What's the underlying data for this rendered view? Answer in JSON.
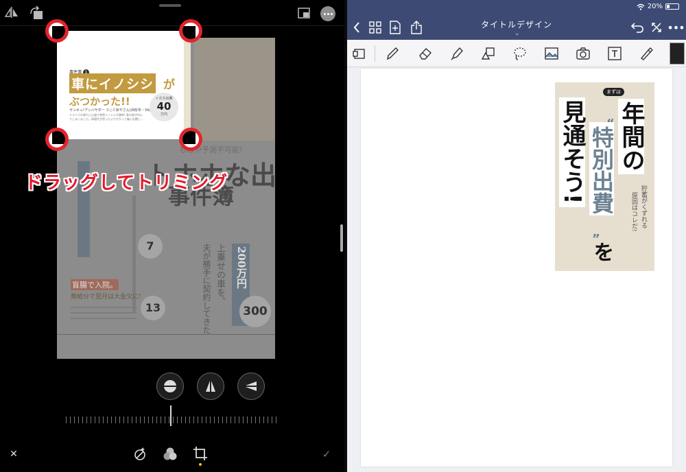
{
  "left_pane": {
    "overlay_label": "ドラッグしてトリミング",
    "photo_crop": {
      "case_tag": "事件簿",
      "case_num": "1",
      "headline_main": "車にイノシシ",
      "headline_particle": "が",
      "headline_sub": "ぶつかった!!",
      "byline": "サンキュ!アンバサダー ミ○ミあやさん(浜松市・34歳)",
      "body": "ドライブの帰りに山道で突然イノシシが激突! 車の前が凹んでしまいました。修理代が思ったよりかかって痛い出費に…",
      "price_label": "トホホ出費",
      "price_value": "40",
      "price_unit": "万円"
    },
    "photo_bg": {
      "big_title_1": "トホホな出費",
      "big_title_2": "事件簿",
      "tagline": "もはや予測不可能!",
      "price_2": "7",
      "price_3": "200万円",
      "price_3_tag": "予算額より",
      "price_4": "13",
      "price_5": "300",
      "headline_4": "盲腸で入院。",
      "headline_4b": "無給分で翌月は大金欠に!",
      "col_text_1": "上乗せの車を、",
      "col_text_2": "夫が勝手に契約してきた"
    }
  },
  "right_pane": {
    "status": {
      "battery": "20%"
    },
    "title": "タイトルデザイン",
    "card": {
      "mazuha": "まずは",
      "col_nenkan": "年間の",
      "col_tokubetsu": "特別出費",
      "col_wo": "を",
      "col_mitooso": "見通そう!",
      "sub_1": "貯蓄がくずれる",
      "sub_2": "原因はコレだ!"
    }
  },
  "colors": {
    "accent_red": "#e3242b",
    "navbar": "#3d4b74",
    "headline_gold": "#c29a3f",
    "slate_blue": "#6c8192",
    "crop_yellow_dot": "#f5c400"
  }
}
